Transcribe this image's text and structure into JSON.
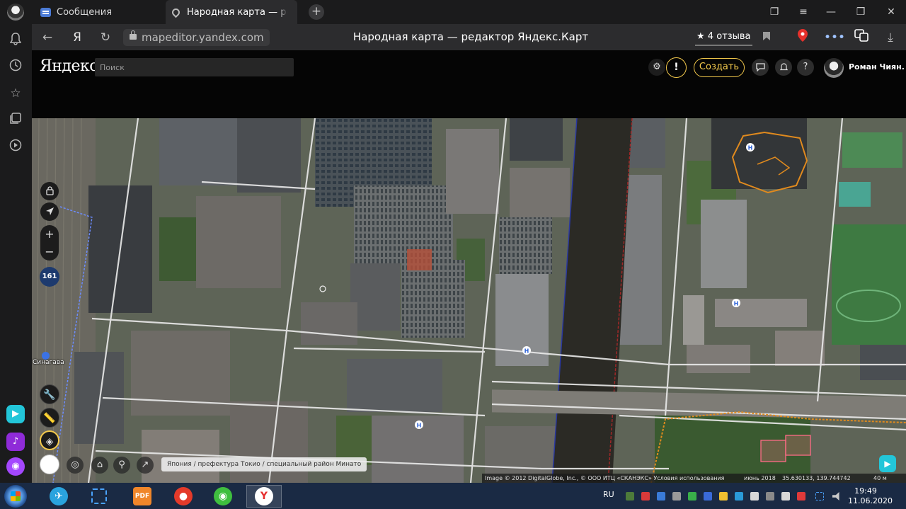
{
  "browser": {
    "tabs": [
      {
        "label": "Сообщения",
        "icon": "message-icon"
      },
      {
        "label": "Народная карта — ре",
        "icon": "map-pin-icon",
        "active": true
      }
    ],
    "url": "mapeditor.yandex.com",
    "page_title": "Народная карта — редактор Яндекс.Карт",
    "reviews": "★ 4 отзыва",
    "back_icon": "←",
    "yandex_icon": "Я",
    "reload_icon": "↻",
    "new_tab_icon": "+"
  },
  "header": {
    "logo": "Яндекс",
    "search_placeholder": "Поиск",
    "warning_icon": "!",
    "create_label": "Создать",
    "help_icon": "?",
    "user_name": "Роман Чиян..."
  },
  "map": {
    "zoom_level": "161",
    "zoom_in": "+",
    "zoom_out": "−",
    "station_label": "Синагава",
    "breadcrumb": "Япония / префектура Токио / специальный район Минато",
    "copyright": "Image © 2012 DigitalGlobe, Inc., © ООО ИТЦ «СКАНЭКС» Условия использования",
    "imagery_date": "июнь 2018",
    "coordinates": "35.630133, 139.744742",
    "scale": "40 м"
  },
  "taskbar": {
    "language": "RU",
    "time": "19:49",
    "date": "11.06.2020",
    "apps": [
      "telegram-icon",
      "snipping-icon",
      "pdf-icon",
      "ladybug-icon",
      "radio-icon",
      "yandex-browser-icon"
    ]
  },
  "colors": {
    "accent": "#f3c94c",
    "polygon": "#e08a1e",
    "zoom_badge": "#1d3a6e"
  }
}
